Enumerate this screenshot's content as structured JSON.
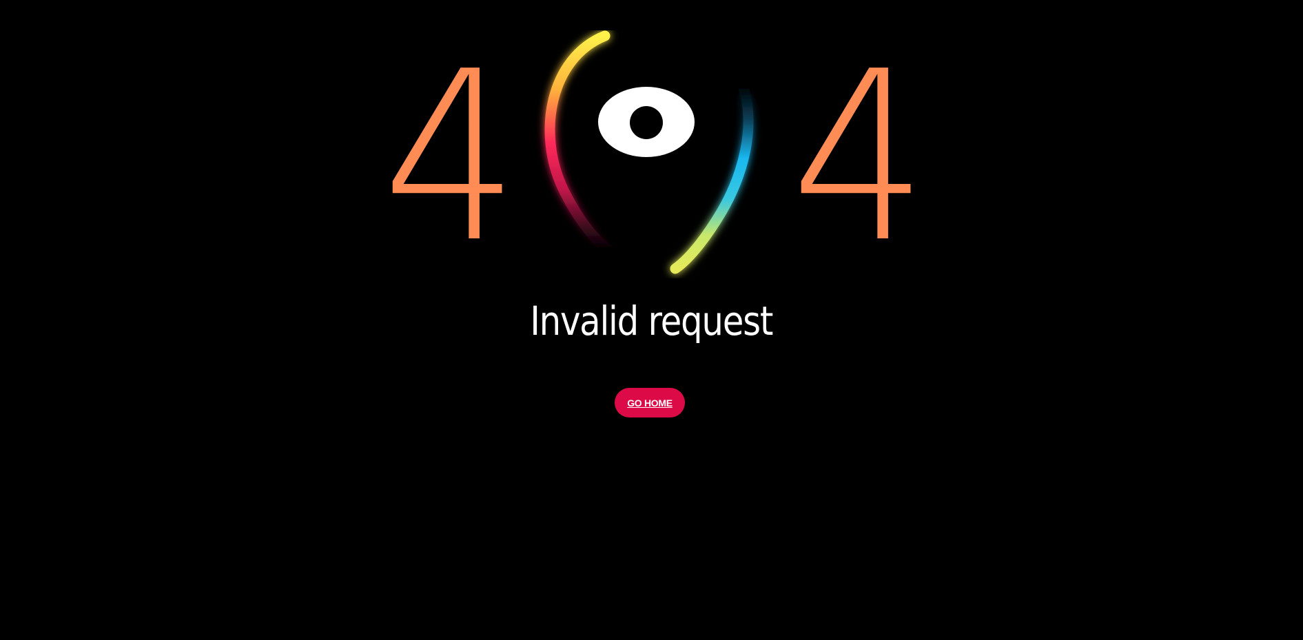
{
  "error": {
    "digit_left": "4",
    "digit_right": "4",
    "digit_color": "#ff8c55",
    "center_icon": "rainbow-eye-icon"
  },
  "message": {
    "heading": "Invalid request"
  },
  "actions": {
    "home_label": "GO HOME",
    "home_color": "#dc0a46"
  },
  "theme": {
    "background": "#000000"
  }
}
